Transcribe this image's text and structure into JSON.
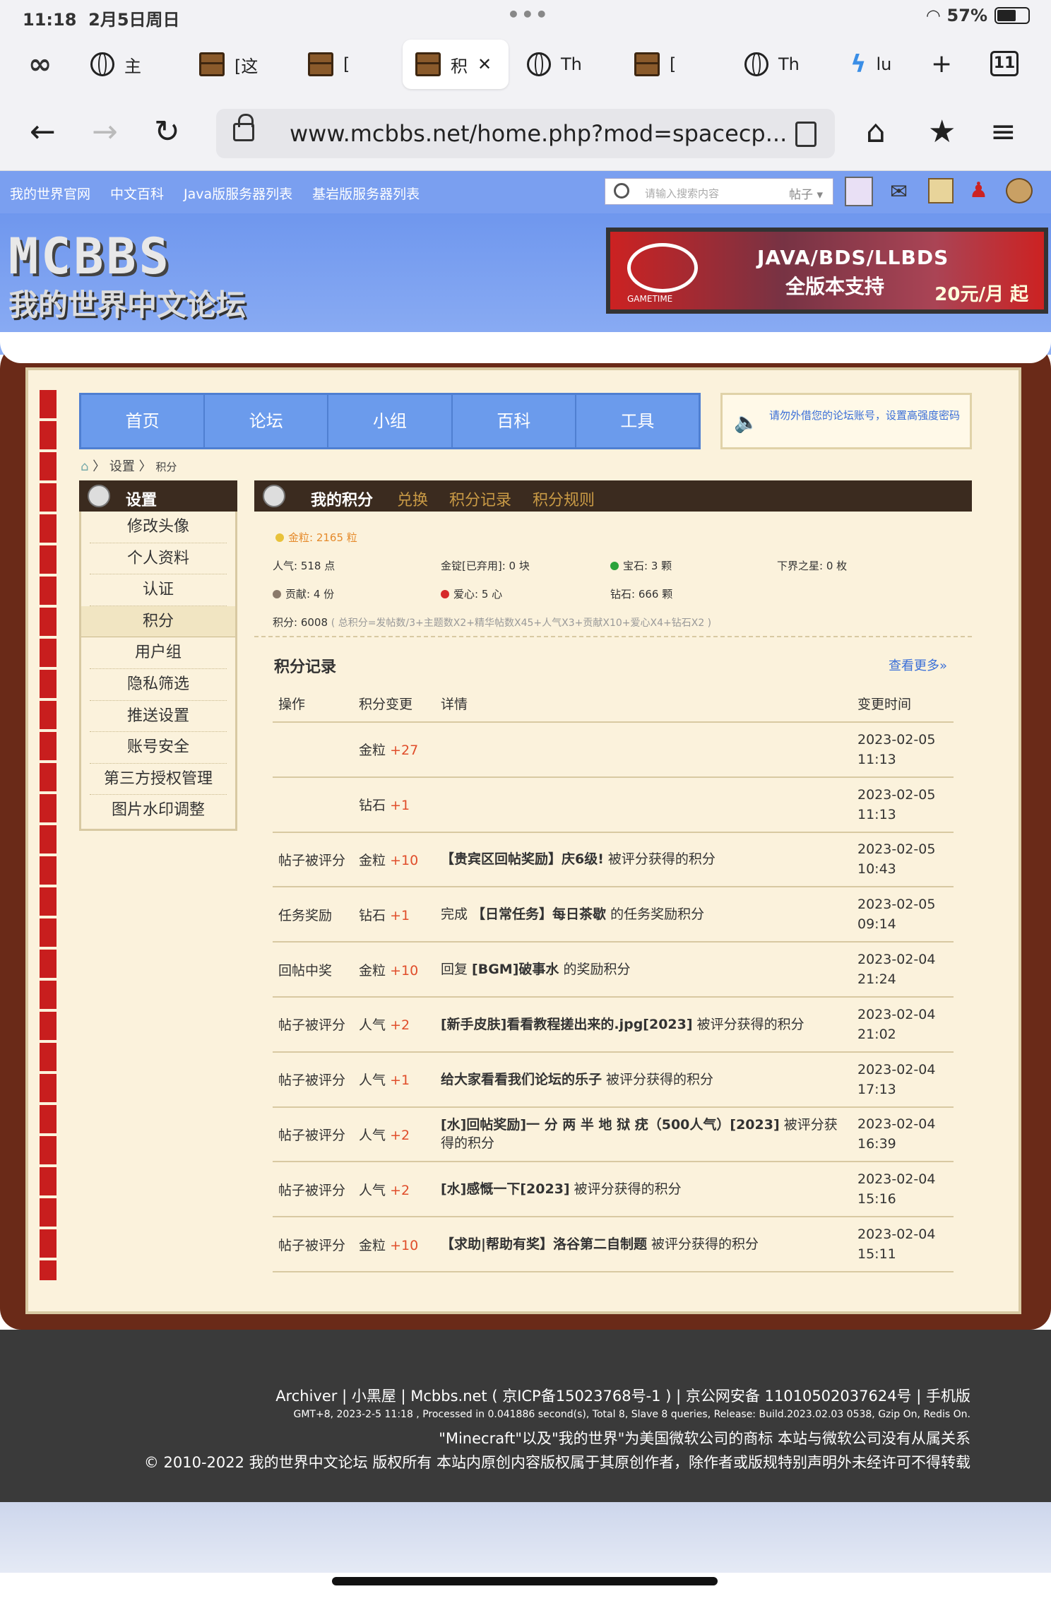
{
  "status": {
    "time": "11:18",
    "date": "2月5日周日",
    "battery": "57%"
  },
  "browser": {
    "tabs": [
      {
        "label": "主",
        "icon": "globe-icon"
      },
      {
        "label": "[这",
        "icon": "chest-icon"
      },
      {
        "label": "[",
        "icon": "chest-icon"
      },
      {
        "label": "积",
        "icon": "chest-icon",
        "active": true
      },
      {
        "label": "Th",
        "icon": "globe-icon"
      },
      {
        "label": "[",
        "icon": "chest-icon"
      },
      {
        "label": "Th",
        "icon": "globe-icon"
      },
      {
        "label": "lu",
        "icon": "app-icon"
      }
    ],
    "tab_count": "11",
    "url": "www.mcbbs.net/home.php?mod=spacecp..."
  },
  "site": {
    "top_links": [
      "我的世界官网",
      "中文百科",
      "Java版服务器列表",
      "基岩版服务器列表"
    ],
    "search_placeholder": "请输入搜索内容",
    "search_scope": "帖子",
    "logo_line1": "MCBBS",
    "logo_line2": "我的世界中文论坛",
    "banner_line1": "JAVA/BDS/LLBDS",
    "banner_line2": "全版本支持",
    "banner_line3": "20元/月 起",
    "banner_brand": "GAMETIME",
    "nav": [
      "首页",
      "论坛",
      "小组",
      "百科",
      "工具"
    ],
    "notice": "请勿外借您的论坛账号，设置高强度密码",
    "breadcrumb": [
      "设置",
      "积分"
    ]
  },
  "sidebar": {
    "title": "设置",
    "items": [
      "修改头像",
      "个人资料",
      "认证",
      "积分",
      "用户组",
      "隐私筛选",
      "推送设置",
      "账号安全",
      "第三方授权管理",
      "图片水印调整"
    ],
    "active_index": 3
  },
  "main": {
    "tabs": [
      "我的积分",
      "兑换",
      "积分记录",
      "积分规则"
    ],
    "credits": {
      "gold": "金粒: 2165 粒",
      "popularity": "人气: 518 点",
      "ingot": "金锭[已弃用]: 0 块",
      "gem": "宝石: 3 颗",
      "nether_star": "下界之星: 0 枚",
      "contribution": "贡献: 4 份",
      "love": "爱心: 5 心",
      "diamond": "钻石: 666 颗",
      "total": "积分: 6008",
      "formula": "( 总积分=发帖数/3+主题数X2+精华帖数X45+人气X3+贡献X10+爱心X4+钻石X2 )"
    },
    "records_title": "积分记录",
    "more": "查看更多»",
    "columns": [
      "操作",
      "积分变更",
      "详情",
      "变更时间"
    ],
    "rows": [
      {
        "op": "",
        "type": "金粒",
        "delta": "+27",
        "pre": "",
        "bold": "",
        "post": "",
        "date": "2023-02-05",
        "time": "11:13"
      },
      {
        "op": "",
        "type": "钻石",
        "delta": "+1",
        "pre": "",
        "bold": "",
        "post": "",
        "date": "2023-02-05",
        "time": "11:13"
      },
      {
        "op": "帖子被评分",
        "type": "金粒",
        "delta": "+10",
        "pre": "",
        "bold": "【贵宾区回帖奖励】庆6级!",
        "post": " 被评分获得的积分",
        "date": "2023-02-05",
        "time": "10:43"
      },
      {
        "op": "任务奖励",
        "type": "钻石",
        "delta": "+1",
        "pre": "完成 ",
        "bold": "【日常任务】每日茶歇",
        "post": " 的任务奖励积分",
        "date": "2023-02-05",
        "time": "09:14"
      },
      {
        "op": "回帖中奖",
        "type": "金粒",
        "delta": "+10",
        "pre": "回复 ",
        "bold": "[BGM]破事水",
        "post": " 的奖励积分",
        "date": "2023-02-04",
        "time": "21:24"
      },
      {
        "op": "帖子被评分",
        "type": "人气",
        "delta": "+2",
        "pre": "",
        "bold": "[新手皮肤]看看教程搓出来的.jpg[2023]",
        "post": " 被评分获得的积分",
        "date": "2023-02-04",
        "time": "21:02"
      },
      {
        "op": "帖子被评分",
        "type": "人气",
        "delta": "+1",
        "pre": "",
        "bold": "给大家看看我们论坛的乐子",
        "post": " 被评分获得的积分",
        "date": "2023-02-04",
        "time": "17:13"
      },
      {
        "op": "帖子被评分",
        "type": "人气",
        "delta": "+2",
        "pre": "",
        "bold": "[水]回帖奖励]一 分 两 半 地 狱 疣（500人气）[2023]",
        "post": " 被评分获得的积分",
        "date": "2023-02-04",
        "time": "16:39"
      },
      {
        "op": "帖子被评分",
        "type": "人气",
        "delta": "+2",
        "pre": "",
        "bold": "[水]感慨一下[2023]",
        "post": " 被评分获得的积分",
        "date": "2023-02-04",
        "time": "15:16"
      },
      {
        "op": "帖子被评分",
        "type": "金粒",
        "delta": "+10",
        "pre": "",
        "bold": "【求助|帮助有奖】洛谷第二自制题",
        "post": " 被评分获得的积分",
        "date": "2023-02-04",
        "time": "15:11"
      }
    ]
  },
  "footer": {
    "line1": "Archiver | 小黑屋 | Mcbbs.net ( 京ICP备15023768号-1 ) | 京公网安备 11010502037624号 | 手机版",
    "line2": "GMT+8, 2023-2-5 11:18 , Processed in 0.041886 second(s), Total 8, Slave 8 queries, Release: Build.2023.02.03 0538, Gzip On, Redis On.",
    "line3": "\"Minecraft\"以及\"我的世界\"为美国微软公司的商标 本站与微软公司没有从属关系",
    "line4": "© 2010-2022 我的世界中文论坛 版权所有 本站内原创内容版权属于其原创作者，除作者或版规特别声明外未经许可不得转载"
  }
}
